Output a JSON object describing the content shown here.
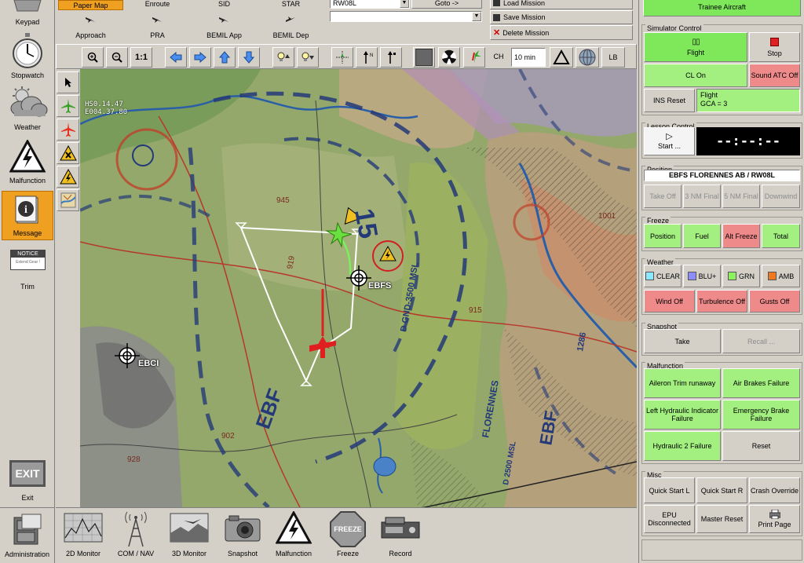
{
  "left_sidebar": {
    "items": [
      {
        "label": "Keypad"
      },
      {
        "label": "Stopwatch"
      },
      {
        "label": "Weather"
      },
      {
        "label": "Malfunction"
      },
      {
        "label": "Message"
      },
      {
        "label": "Trim",
        "badge_top": "NOTICE",
        "badge_bottom": "Extend Gear !"
      }
    ],
    "exit_label": "Exit",
    "exit_icon_text": "EXIT",
    "admin_label": "Administration"
  },
  "top_toolbar": {
    "procedures_row1": [
      "Paper Map",
      "Enroute",
      "SID",
      "STAR"
    ],
    "procedures_row2": [
      "Approach",
      "PRA",
      "BEMIL App",
      "BEMIL Dep"
    ],
    "runway_select": "RW08L",
    "goto_label": "Goto ->",
    "empty_select": "",
    "load_mission": "Load Mission",
    "save_mission": "Save Mission",
    "delete_mission": "Delete Mission"
  },
  "map_toolbar": {
    "zoom_reset": "1:1",
    "ch_label": "CH",
    "time_value": "10 min",
    "lb_label": "LB"
  },
  "map": {
    "coord_line1": "HS0.14.47",
    "coord_line2": "E004.37.80",
    "airport1": "EBFS",
    "airport2": "EBCI"
  },
  "bottom_toolbar": {
    "items": [
      "2D Monitor",
      "COM / NAV",
      "3D Monitor",
      "Snapshot",
      "Malfunction",
      "Freeze",
      "Record"
    ],
    "freeze_sign": "FREEZE"
  },
  "right_panel": {
    "trainee_aircraft": "Trainee Aircraft",
    "simulator_control": {
      "title": "Simulator Control",
      "flight": "Flight",
      "stop": "Stop",
      "cl_on": "CL On",
      "sound_atc": "Sound ATC Off",
      "ins_reset": "INS Reset",
      "status_line1": "Flight",
      "status_line2": "GCA = 3"
    },
    "lesson_control": {
      "title": "Lesson Control",
      "start": "Start ...",
      "timer": "--:--:--"
    },
    "position": {
      "title": "Position",
      "value": "EBFS FLORENNES AB / RW08L",
      "buttons": [
        "Take Off",
        "3 NM Final",
        "5 NM Final",
        "Downwind"
      ]
    },
    "freeze": {
      "title": "Freeze",
      "buttons": [
        "Position",
        "Fuel",
        "Alt Freeze",
        "Total"
      ]
    },
    "weather": {
      "title": "Weather",
      "colors": [
        {
          "label": "CLEAR",
          "swatch": "#8ce8ff"
        },
        {
          "label": "BLU+",
          "swatch": "#8c8cff"
        },
        {
          "label": "GRN",
          "swatch": "#8cf060"
        },
        {
          "label": "AMB",
          "swatch": "#f07820"
        }
      ],
      "wind": "Wind Off",
      "turbulence": "Turbulence Off",
      "gusts": "Gusts Off"
    },
    "snapshot": {
      "title": "Snapshot",
      "take": "Take",
      "recall": "Recall ..."
    },
    "malfunction": {
      "title": "Malfunction",
      "buttons": [
        "Aileron Trim runaway",
        "Air Brakes Failure",
        "Left Hydraulic Indicator Failure",
        "Emergency Brake Failure",
        "Hydraulic 2 Failure",
        "Reset"
      ]
    },
    "misc": {
      "title": "Misc",
      "buttons": [
        "Quick Start L",
        "Quick Start R",
        "Crash Override",
        "EPU Disconnected",
        "Master Reset",
        "Print Page"
      ]
    }
  },
  "colors": {
    "panel": "#d4d0c8",
    "active_green": "#a3f080",
    "alert_red": "#ef8a8a",
    "selected_orange": "#f0a020"
  }
}
